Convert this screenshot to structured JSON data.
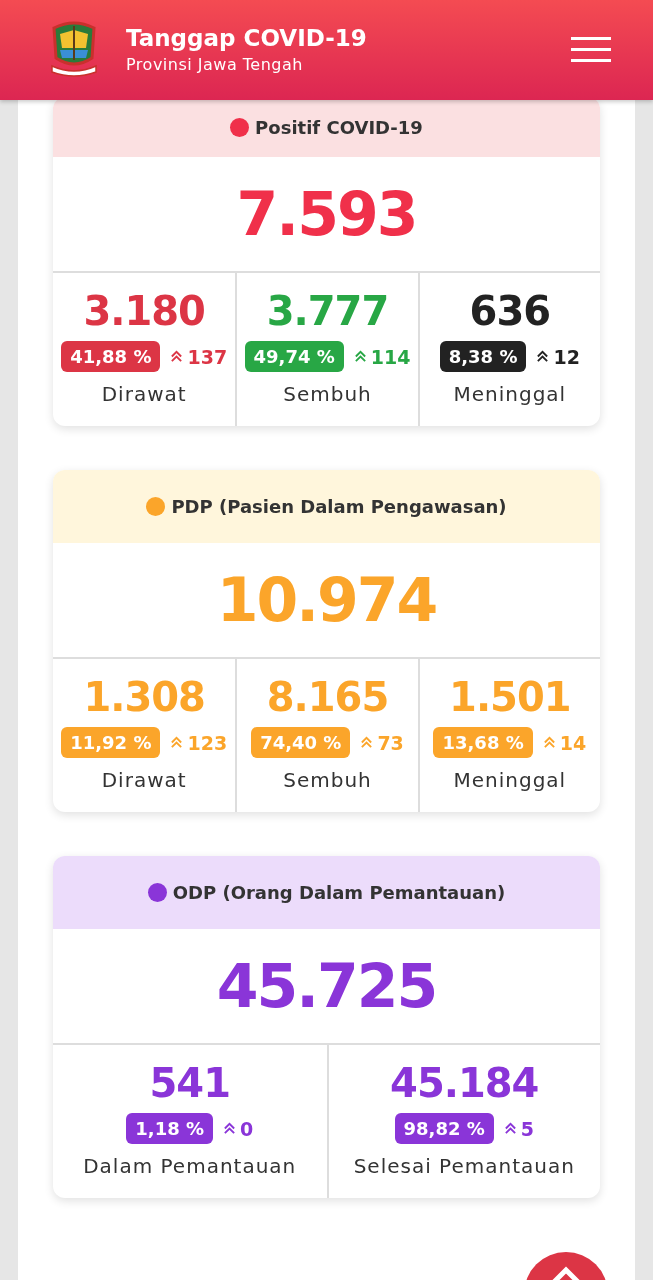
{
  "header": {
    "title": "Tanggap COVID-19",
    "subtitle": "Provinsi Jawa Tengah"
  },
  "cards": [
    {
      "title": "Positif COVID-19",
      "color": "#f0304a",
      "kind": "positif",
      "total": "7.593",
      "stats": [
        {
          "value": "3.180",
          "percent": "41,88 %",
          "increase": "137",
          "label": "Dirawat",
          "color": "#dc3545"
        },
        {
          "value": "3.777",
          "percent": "49,74 %",
          "increase": "114",
          "label": "Sembuh",
          "color": "#28a745"
        },
        {
          "value": "636",
          "percent": "8,38 %",
          "increase": "12",
          "label": "Meninggal",
          "color": "#222222"
        }
      ]
    },
    {
      "title": "PDP (Pasien Dalam Pengawasan)",
      "color": "#fba52a",
      "kind": "pdp",
      "total": "10.974",
      "stats": [
        {
          "value": "1.308",
          "percent": "11,92 %",
          "increase": "123",
          "label": "Dirawat",
          "color": "#fba52a"
        },
        {
          "value": "8.165",
          "percent": "74,40 %",
          "increase": "73",
          "label": "Sembuh",
          "color": "#fba52a"
        },
        {
          "value": "1.501",
          "percent": "13,68 %",
          "increase": "14",
          "label": "Meninggal",
          "color": "#fba52a"
        }
      ]
    },
    {
      "title": "ODP (Orang Dalam Pemantauan)",
      "color": "#8a35d8",
      "kind": "odp",
      "total": "45.725",
      "stats": [
        {
          "value": "541",
          "percent": "1,18 %",
          "increase": "0",
          "label": "Dalam Pemantauan",
          "color": "#8a35d8"
        },
        {
          "value": "45.184",
          "percent": "98,82 %",
          "increase": "5",
          "label": "Selesai Pemantauan",
          "color": "#8a35d8"
        }
      ]
    }
  ]
}
